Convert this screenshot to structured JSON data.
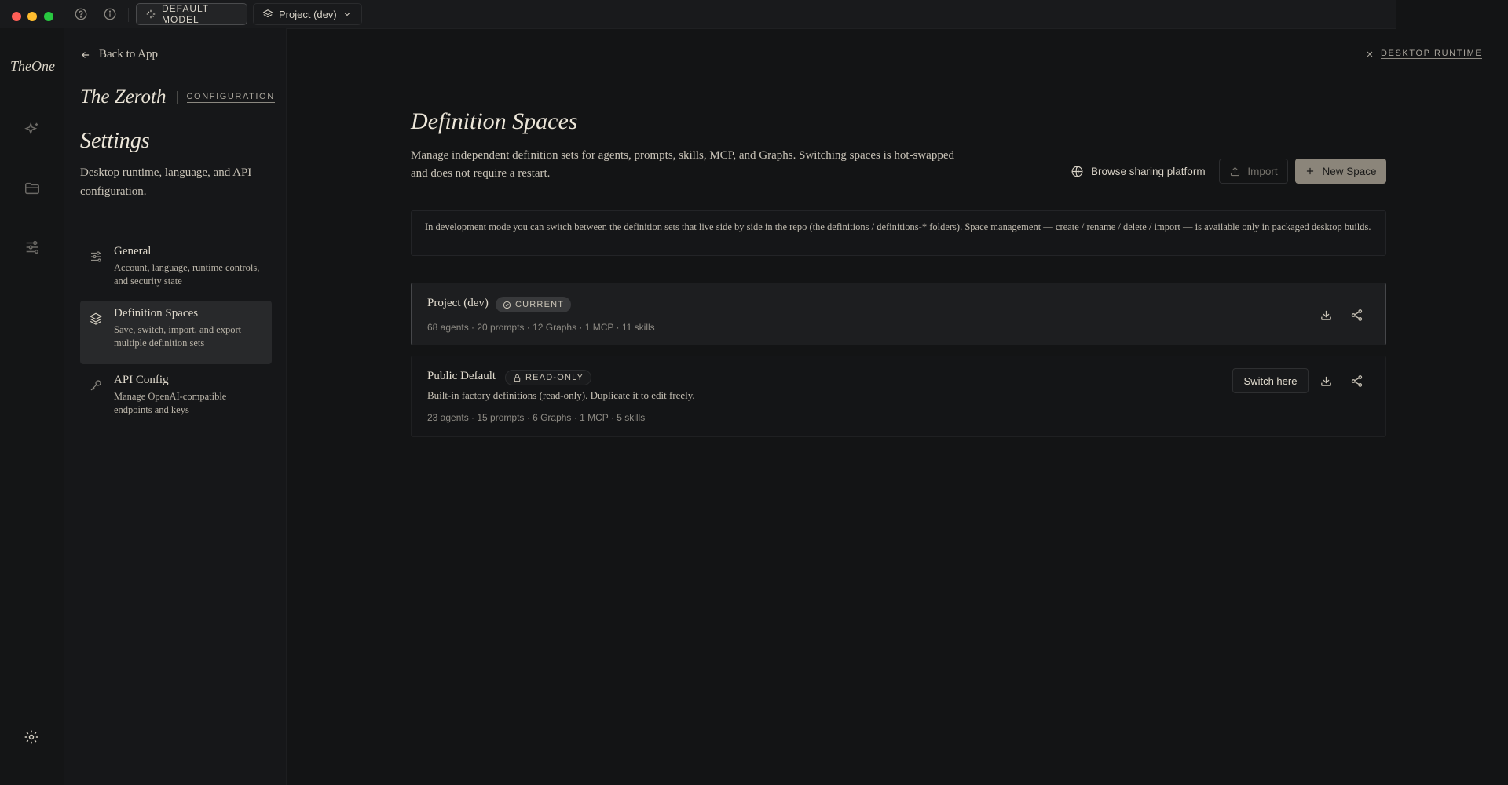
{
  "topbar": {
    "model_label": "DEFAULT MODEL",
    "project_label": "Project (dev)"
  },
  "rail": {
    "brand": "TheOne"
  },
  "sidebar": {
    "back_label": "Back to App",
    "app_title": "The Zeroth",
    "app_section": "CONFIGURATION",
    "heading": "Settings",
    "subheading": "Desktop runtime, language, and API configuration.",
    "items": [
      {
        "title": "General",
        "desc": "Account, language, runtime controls, and security state",
        "icon": "sliders-icon"
      },
      {
        "title": "Definition Spaces",
        "desc": "Save, switch, import, and export multiple definition sets",
        "icon": "layers-icon"
      },
      {
        "title": "API Config",
        "desc": "Manage OpenAI-compatible endpoints and keys",
        "icon": "key-icon"
      }
    ]
  },
  "main": {
    "close_label": "DESKTOP RUNTIME",
    "title": "Definition Spaces",
    "description": "Manage independent definition sets for agents, prompts, skills, MCP, and Graphs. Switching spaces is hot-swapped and does not require a restart.",
    "browse_label": "Browse sharing platform",
    "import_label": "Import",
    "new_label": "New Space",
    "info": "In development mode you can switch between the definition sets that live side by side in the repo (the definitions / definitions-* folders). Space management — create / rename / delete / import — is available only in packaged desktop builds.",
    "spaces": [
      {
        "name": "Project (dev)",
        "badge": "CURRENT",
        "meta": "68 agents · 20 prompts · 12 Graphs · 1 MCP · 11 skills"
      },
      {
        "name": "Public Default",
        "badge": "READ-ONLY",
        "desc": "Built-in factory definitions (read-only). Duplicate it to edit freely.",
        "meta": "23 agents · 15 prompts · 6 Graphs · 1 MCP · 5 skills",
        "switch_label": "Switch here"
      }
    ]
  },
  "colors": {
    "background": "#131415",
    "accent_button": "#8b857a",
    "text": "#e6e1d6"
  }
}
